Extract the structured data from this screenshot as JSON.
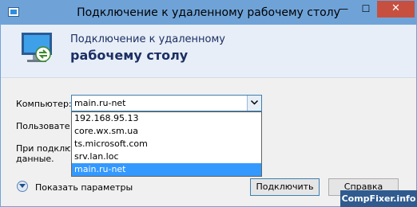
{
  "window": {
    "title": "Подключение к удаленному рабочему столу",
    "minimize_glyph": "—",
    "maximize_glyph": "☐",
    "close_glyph": "✕"
  },
  "header": {
    "line1": "Подключение к удаленному",
    "line2": "рабочему столу",
    "icon": "remote-desktop-monitor-icon"
  },
  "form": {
    "computer_label": "Компьютер:",
    "computer_value": "main.ru-net",
    "user_label": "Пользователь",
    "note_line1": "При подключении",
    "note_line2": "данные."
  },
  "dropdown": {
    "items": [
      "192.168.95.13",
      "core.wx.sm.ua",
      "ts.microsoft.com",
      "srv.lan.loc",
      "main.ru-net"
    ],
    "selected_index": 4
  },
  "footer": {
    "show_params_label": "Показать параметры",
    "connect_label": "Подключить",
    "help_label": "Справка"
  },
  "watermark": "CompFixer.info",
  "colors": {
    "titlebar": "#6fa3d8",
    "close_button": "#c74f3f",
    "selection": "#3399ff",
    "header_text": "#1c2f64"
  }
}
